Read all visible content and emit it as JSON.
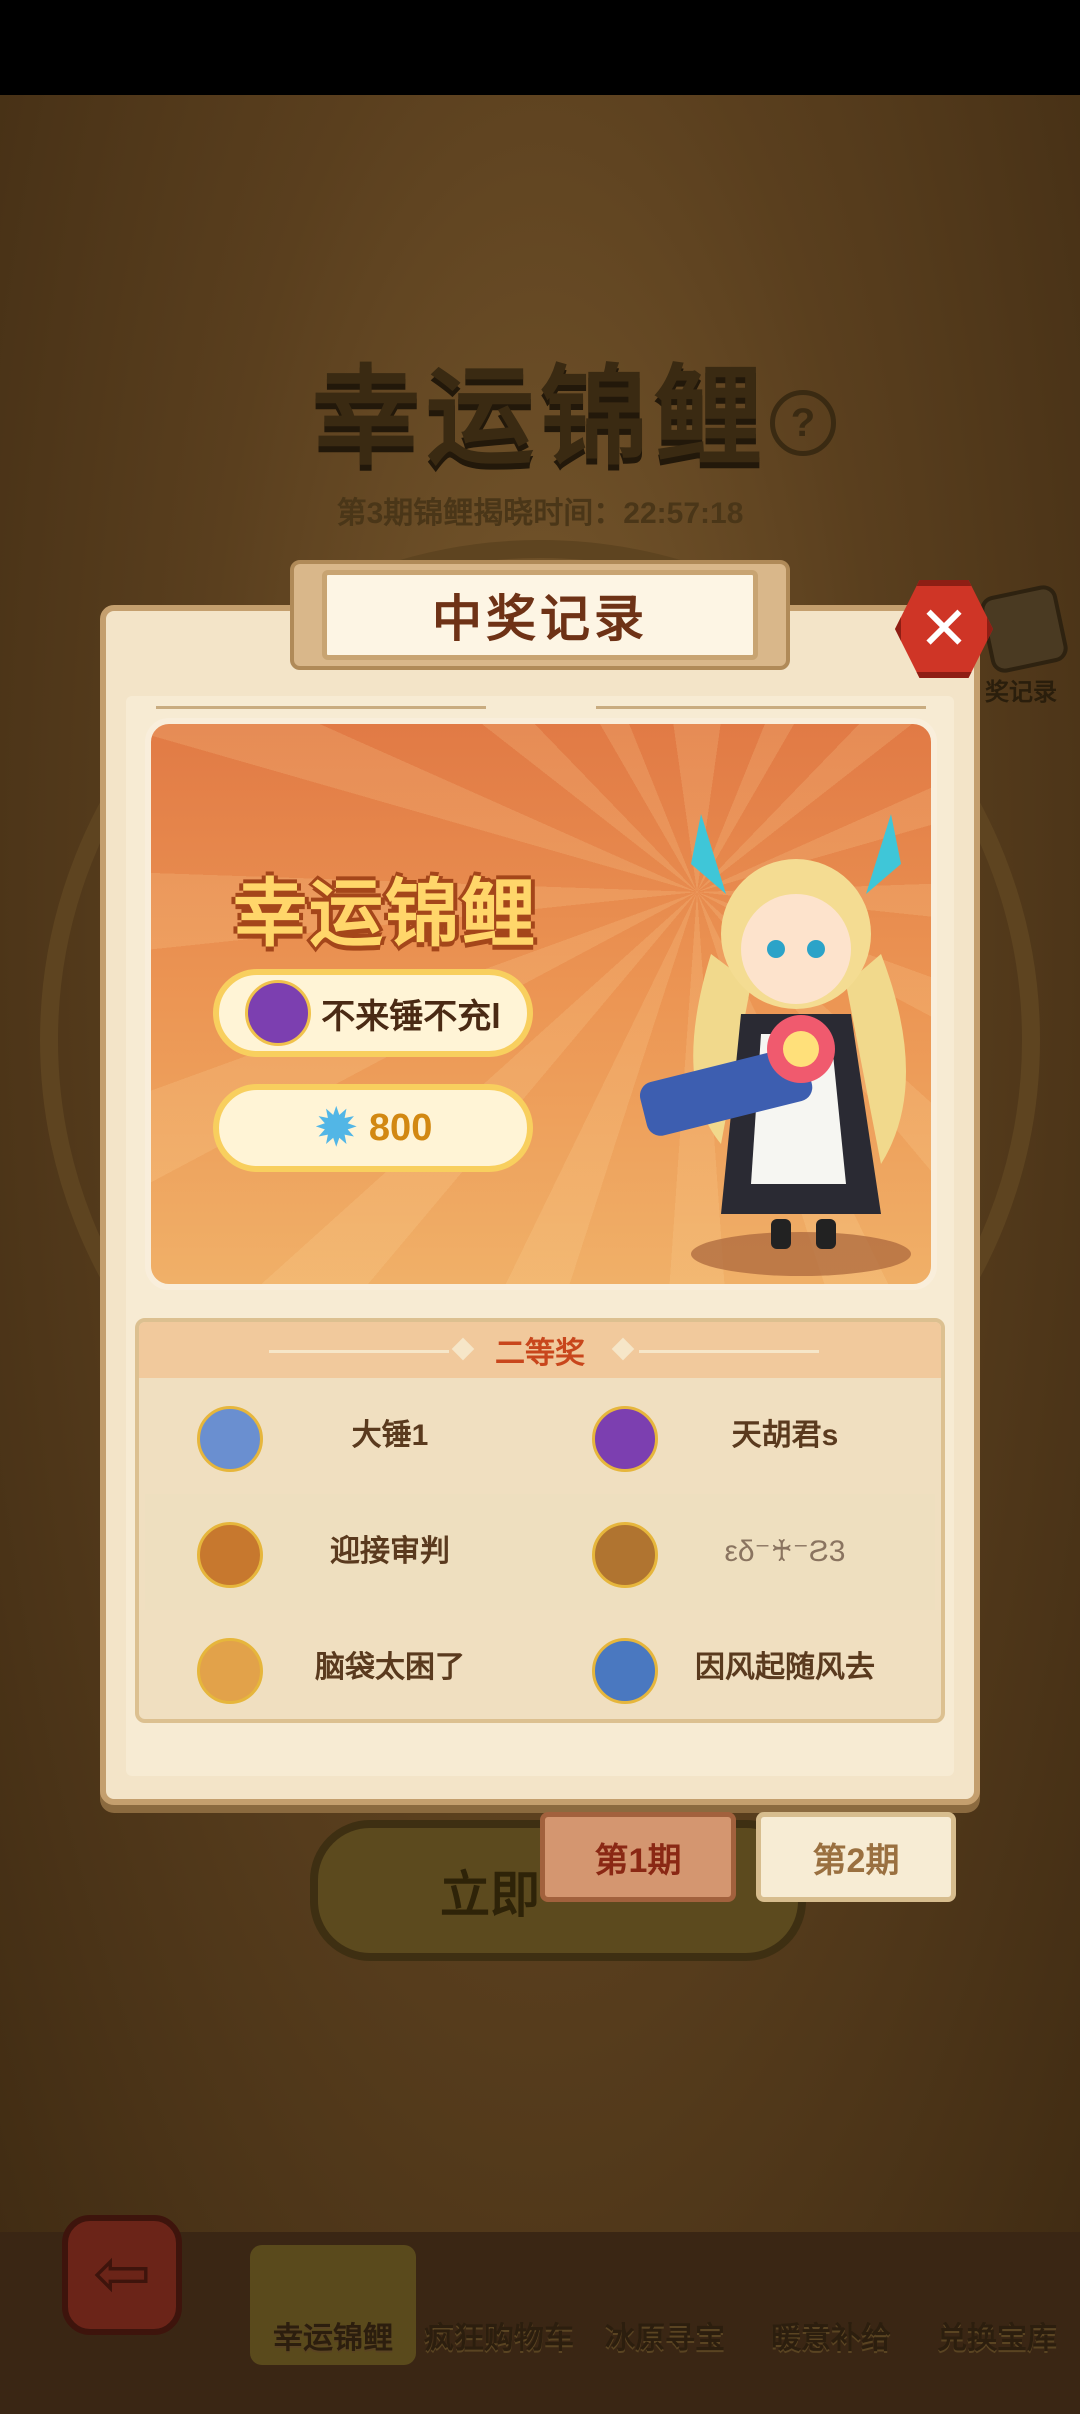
{
  "background": {
    "title": "幸运锦鲤",
    "help_icon": "question-icon",
    "reveal_time": "第3期锦鲤揭晓时间：22:57:18",
    "record_label": "奖记录",
    "action_button": "立即",
    "back_icon": "back-arrow-icon",
    "tabs": [
      {
        "label": "幸运锦鲤",
        "active": true
      },
      {
        "label": "疯狂购物车",
        "active": false
      },
      {
        "label": "冰原寻宝",
        "active": false
      },
      {
        "label": "暖意补给",
        "active": false
      },
      {
        "label": "兑换宝库",
        "active": false
      }
    ]
  },
  "modal": {
    "title": "中奖记录",
    "close_icon": "close-x-icon",
    "banner": {
      "title": "幸运锦鲤",
      "winner_name": "不来锤不充l",
      "reward_amount": "800",
      "reward_icon": "crystal-star-icon"
    },
    "second_prize": {
      "header": "二等奖",
      "winners": [
        {
          "name": "大锤1",
          "avatar_color": "#6a8fd0"
        },
        {
          "name": "天胡君s",
          "avatar_color": "#7c3fb0"
        },
        {
          "name": "迎接审判",
          "avatar_color": "#c7782e"
        },
        {
          "name": "εδ⁻♰⁻Ƨ3",
          "avatar_color": "#b07430"
        },
        {
          "name": "脑袋太困了",
          "avatar_color": "#e2a24a"
        },
        {
          "name": "因风起随风去",
          "avatar_color": "#4a78c0"
        }
      ]
    },
    "periods": [
      {
        "label": "第1期",
        "active": true
      },
      {
        "label": "第2期",
        "active": false
      }
    ]
  },
  "colors": {
    "accent_red": "#cf3526",
    "banner_orange": "#e17a45",
    "gold": "#ffd66a",
    "panel_cream": "#f7ebd3"
  }
}
